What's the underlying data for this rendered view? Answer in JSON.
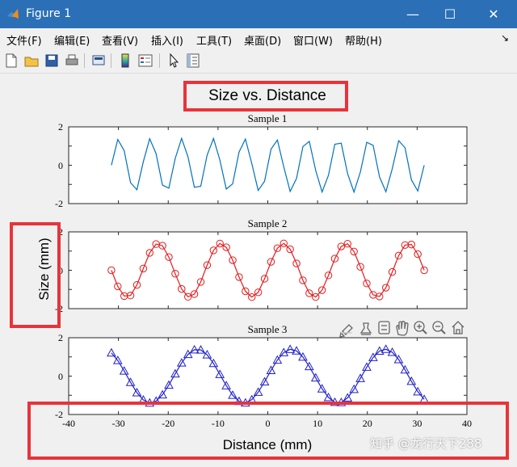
{
  "window": {
    "title": "Figure 1",
    "minimize": "—",
    "maximize": "☐",
    "close": "✕"
  },
  "menu": {
    "items": [
      "文件(F)",
      "编辑(E)",
      "查看(V)",
      "插入(I)",
      "工具(T)",
      "桌面(D)",
      "窗口(W)",
      "帮助(H)"
    ],
    "overflow_arrow": "↘"
  },
  "toolbar": {
    "icons": [
      "new-figure-icon",
      "open-file-icon",
      "save-icon",
      "print-icon",
      "link-plot-icon",
      "insert-colorbar-icon",
      "insert-legend-icon",
      "edit-plot-icon",
      "property-inspector-icon"
    ]
  },
  "figure": {
    "suptitle": "Size vs. Distance",
    "ylabel": "Size (mm)",
    "xlabel": "Distance (mm)"
  },
  "axes_toolbar": {
    "icons": [
      "brush-icon",
      "data-tips-icon",
      "export-icon",
      "pan-icon",
      "zoom-in-icon",
      "zoom-out-icon",
      "home-icon"
    ]
  },
  "watermark": "知乎 @龙行天下288",
  "colors": {
    "accent": "#2b6fb6",
    "highlight_box": "#e8333a",
    "series1": "#0072bd",
    "series2": "#e41a1c",
    "series3": "#2020c8"
  },
  "chart_data": [
    {
      "type": "line",
      "title": "Sample 1",
      "x_range": [
        -31.4159,
        31.4159
      ],
      "function": "sin(x)",
      "xlim": [
        -40,
        40
      ],
      "ylim": [
        -2,
        2
      ],
      "yticks": [
        "2",
        "0",
        "-2"
      ],
      "marker": "none",
      "line_color": "#0072bd"
    },
    {
      "type": "line",
      "title": "Sample 2",
      "x_range": [
        -31.4159,
        31.4159
      ],
      "function": "sin(x/2)",
      "xlim": [
        -40,
        40
      ],
      "ylim": [
        -2,
        2
      ],
      "yticks": [
        "2",
        "0",
        "-2"
      ],
      "marker": "circle",
      "line_color": "#e41a1c"
    },
    {
      "type": "line",
      "title": "Sample 3",
      "x_range": [
        -31.4159,
        31.4159
      ],
      "function": "sin(x/3)",
      "xlim": [
        -40,
        40
      ],
      "ylim": [
        -2,
        2
      ],
      "yticks": [
        "2",
        "0",
        "-2"
      ],
      "xticks": [
        "-40",
        "-30",
        "-20",
        "-10",
        "0",
        "10",
        "20",
        "30",
        "40"
      ],
      "marker": "triangle",
      "line_color": "#2020c8"
    }
  ]
}
